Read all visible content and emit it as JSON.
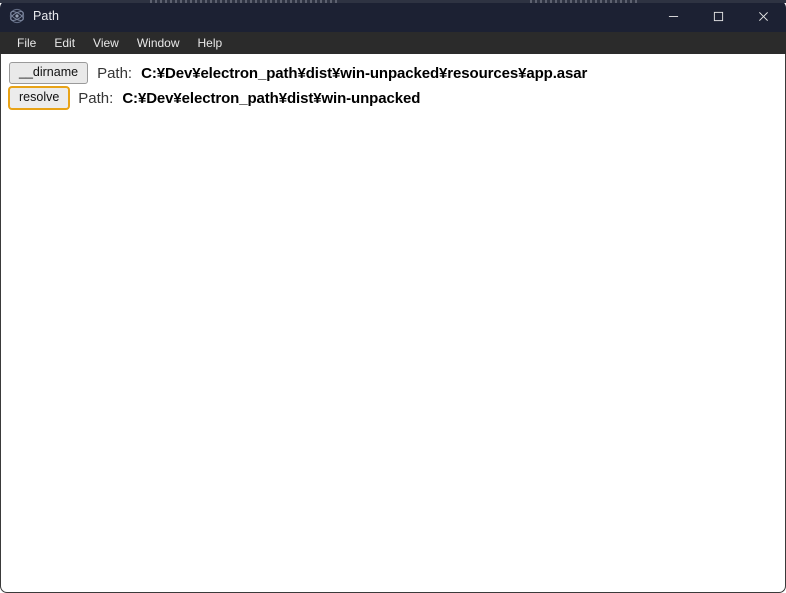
{
  "window": {
    "title": "Path",
    "icon": "electron-atom-icon",
    "controls": {
      "minimize_label": "Minimize",
      "maximize_label": "Maximize",
      "close_label": "Close"
    },
    "colors": {
      "titlebar_bg": "#1c2133",
      "menubar_bg": "#2b2b2b",
      "content_bg": "#ffffff",
      "focus_outline": "#e8a317",
      "button_bg": "#e9e9e9",
      "button_border": "#9a9a9a",
      "title_text": "#e9eaee"
    }
  },
  "menubar": {
    "items": [
      {
        "label": "File"
      },
      {
        "label": "Edit"
      },
      {
        "label": "View"
      },
      {
        "label": "Window"
      },
      {
        "label": "Help"
      }
    ]
  },
  "main": {
    "rows": [
      {
        "button_label": "__dirname",
        "focused": false,
        "prefix": "Path:",
        "value": "C:¥Dev¥electron_path¥dist¥win-unpacked¥resources¥app.asar"
      },
      {
        "button_label": "resolve",
        "focused": true,
        "prefix": "Path:",
        "value": "C:¥Dev¥electron_path¥dist¥win-unpacked"
      }
    ]
  }
}
